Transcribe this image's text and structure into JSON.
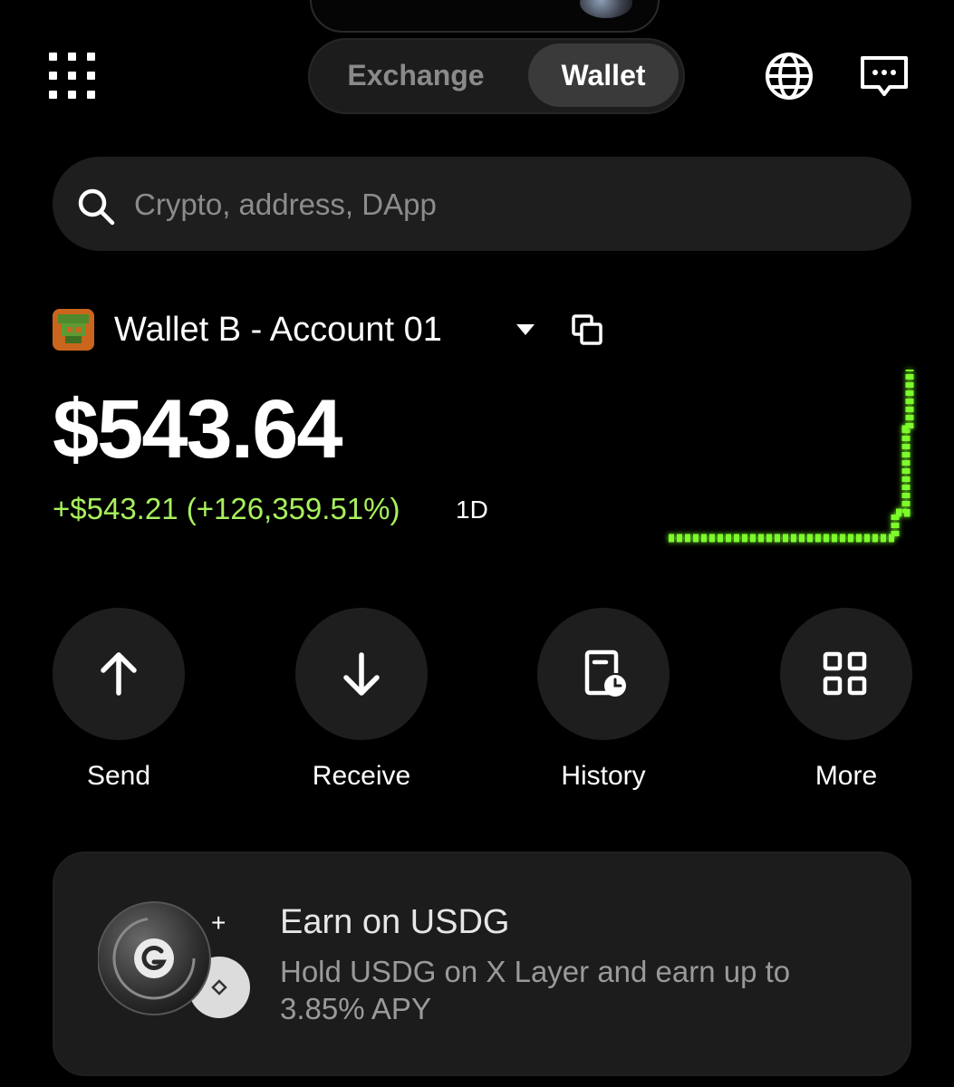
{
  "header": {
    "tabs": [
      {
        "label": "Exchange",
        "active": false
      },
      {
        "label": "Wallet",
        "active": true
      }
    ]
  },
  "search": {
    "placeholder": "Crypto, address, DApp"
  },
  "account": {
    "name": "Wallet B - Account 01",
    "balance": "$543.64",
    "change": "+$543.21 (+126,359.51%)",
    "period": "1D"
  },
  "actions": [
    {
      "label": "Send",
      "icon": "arrow-up-icon"
    },
    {
      "label": "Receive",
      "icon": "arrow-down-icon"
    },
    {
      "label": "History",
      "icon": "history-icon"
    },
    {
      "label": "More",
      "icon": "more-grid-icon"
    }
  ],
  "promo": {
    "title": "Earn on USDG",
    "description": "Hold USDG on X Layer and earn up to 3.85% APY",
    "plus": "+"
  },
  "colors": {
    "background": "#000000",
    "surface": "#1e1e1e",
    "positive": "#a8f05c",
    "sparkline": "#7cfc2a"
  }
}
